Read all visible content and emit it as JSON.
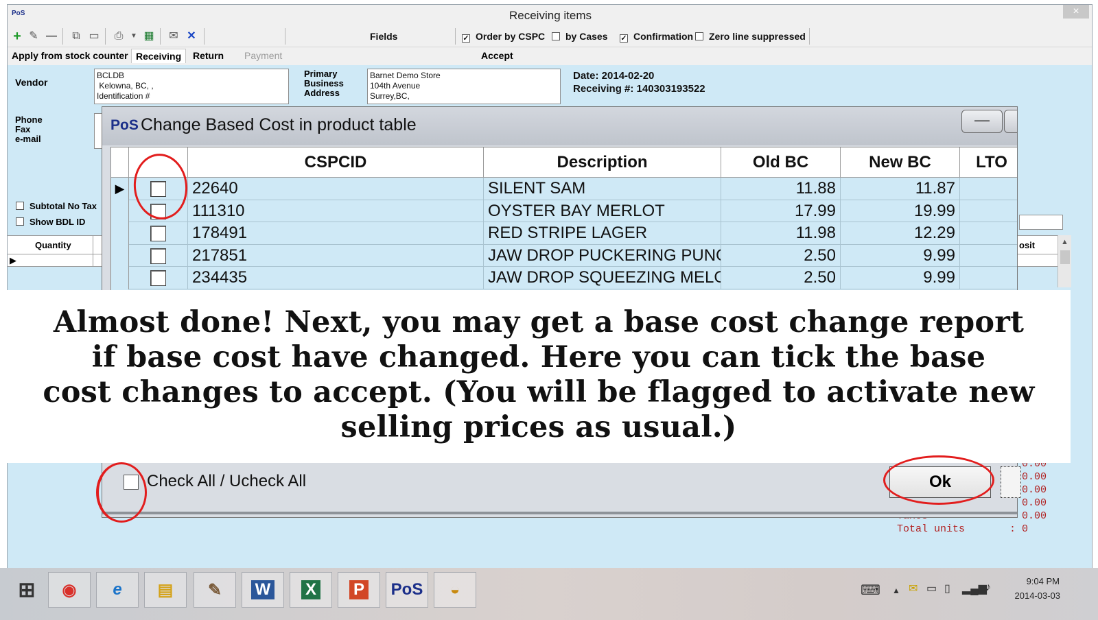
{
  "window": {
    "title": "Receiving items",
    "logo": "PoS",
    "close_icon": "×"
  },
  "toolbar": {
    "fields_label": "Fields",
    "options": [
      {
        "label": "Order by CSPC",
        "checked": true
      },
      {
        "label": "by Cases",
        "checked": false
      },
      {
        "label": "Confirmation",
        "checked": true
      },
      {
        "label": "Zero line suppressed",
        "checked": false
      }
    ]
  },
  "tabs": {
    "apply": "Apply from stock counter",
    "receiving": "Receiving",
    "return": "Return",
    "payment": "Payment",
    "accept": "Accept"
  },
  "vendor": {
    "label": "Vendor",
    "lines": "BCLDB\n Kelowna, BC, ,\nIdentification #",
    "phone_label": "Phone",
    "fax_label": "Fax",
    "email_label": "e-mail"
  },
  "business": {
    "label": "Primary\nBusiness\nAddress",
    "lines": "Barnet Demo Store\n104th Avenue\nSurrey,BC,"
  },
  "receipt": {
    "date": "Date: 2014-02-20",
    "number": "Receiving #: 140303193522"
  },
  "side_options": {
    "subtotal": "Subtotal No Tax",
    "show_bdl": "Show BDL ID"
  },
  "main_grid": {
    "quantity_header": "Quantity",
    "deposit_header": "osit"
  },
  "totals": {
    "values": [
      "0.00",
      "0.00",
      "0.00",
      "0.00",
      "0.00"
    ],
    "taxes_label": "Taxes",
    "total_units_label": "Total units",
    "total_units_value": ": 0"
  },
  "dialog": {
    "logo": "PoS",
    "title": "Change Based Cost in product table",
    "min_icon": "—",
    "columns": [
      "CSPCID",
      "Description",
      "Old BC",
      "New BC",
      "LTO"
    ],
    "rows": [
      {
        "cspcid": "22640",
        "description": "SILENT SAM",
        "old_bc": "11.88",
        "new_bc": "11.87",
        "lto": ""
      },
      {
        "cspcid": "111310",
        "description": "OYSTER BAY MERLOT",
        "old_bc": "17.99",
        "new_bc": "19.99",
        "lto": ""
      },
      {
        "cspcid": "178491",
        "description": "RED STRIPE LAGER",
        "old_bc": "11.98",
        "new_bc": "12.29",
        "lto": ""
      },
      {
        "cspcid": "217851",
        "description": "JAW DROP PUCKERING PUNCH",
        "old_bc": "2.50",
        "new_bc": "9.99",
        "lto": ""
      },
      {
        "cspcid": "234435",
        "description": "JAW DROP SQUEEZING MELONS",
        "old_bc": "2.50",
        "new_bc": "9.99",
        "lto": ""
      }
    ],
    "check_all_label": "Check All / Ucheck All",
    "ok_label": "Ok"
  },
  "caption": {
    "line1": "Almost done! Next, you may get a base cost change report",
    "line2": "if base cost have changed. Here you can tick the base",
    "line3": "cost changes to accept. (You will be flagged to activate new",
    "line4": "selling prices as usual.)"
  },
  "taskbar": {
    "apps": [
      "windows-start",
      "chrome",
      "internet-explorer",
      "file-explorer",
      "paint",
      "word",
      "excel",
      "powerpoint",
      "pos",
      "other-app"
    ],
    "pos_label": "PoS",
    "time": "9:04 PM",
    "date": "2014-03-03"
  },
  "colors": {
    "window_bg": "#cfe9f6",
    "annotation_red": "#e21d1d",
    "pos_blue": "#1b2f8a"
  }
}
